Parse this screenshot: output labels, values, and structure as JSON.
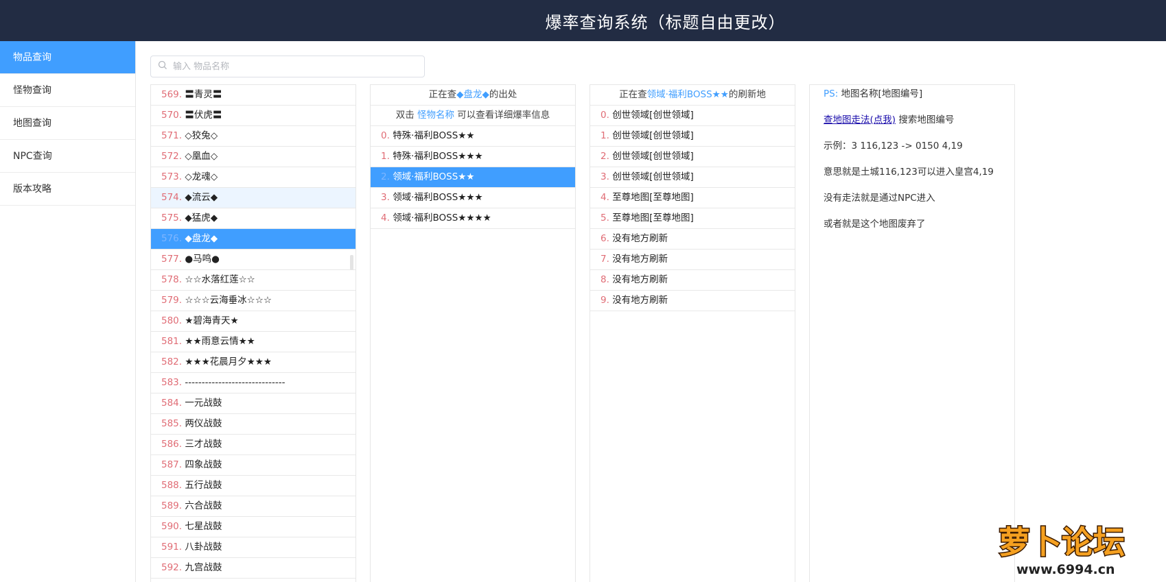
{
  "header": {
    "title": "爆率查询系统（标题自由更改）"
  },
  "sidebar": {
    "items": [
      {
        "label": "物品查询",
        "active": true
      },
      {
        "label": "怪物查询"
      },
      {
        "label": "地图查询"
      },
      {
        "label": "NPC查询"
      },
      {
        "label": "版本攻略"
      }
    ]
  },
  "search": {
    "placeholder": "输入 物品名称",
    "value": ""
  },
  "items_panel": {
    "rows": [
      {
        "idx": "569.",
        "name": "〓青灵〓"
      },
      {
        "idx": "570.",
        "name": "〓伏虎〓"
      },
      {
        "idx": "571.",
        "name": "◇狡兔◇"
      },
      {
        "idx": "572.",
        "name": "◇凰血◇"
      },
      {
        "idx": "573.",
        "name": "◇龙魂◇"
      },
      {
        "idx": "574.",
        "name": "◆流云◆"
      },
      {
        "idx": "575.",
        "name": "◆猛虎◆"
      },
      {
        "idx": "576.",
        "name": "◆盘龙◆"
      },
      {
        "idx": "577.",
        "name": "●马鸣●"
      },
      {
        "idx": "578.",
        "name": "☆☆水落红莲☆☆"
      },
      {
        "idx": "579.",
        "name": "☆☆☆云海垂冰☆☆☆"
      },
      {
        "idx": "580.",
        "name": "★碧海青天★"
      },
      {
        "idx": "581.",
        "name": "★★雨意云情★★"
      },
      {
        "idx": "582.",
        "name": "★★★花晨月夕★★★"
      },
      {
        "idx": "583.",
        "name": "------------------------------"
      },
      {
        "idx": "584.",
        "name": "一元战鼓"
      },
      {
        "idx": "585.",
        "name": "两仪战鼓"
      },
      {
        "idx": "586.",
        "name": "三才战鼓"
      },
      {
        "idx": "587.",
        "name": "四象战鼓"
      },
      {
        "idx": "588.",
        "name": "五行战鼓"
      },
      {
        "idx": "589.",
        "name": "六合战鼓"
      },
      {
        "idx": "590.",
        "name": "七星战鼓"
      },
      {
        "idx": "591.",
        "name": "八卦战鼓"
      },
      {
        "idx": "592.",
        "name": "九宫战鼓"
      }
    ]
  },
  "monster_panel": {
    "head_prefix": "正在查",
    "head_item": "◆盘龙◆",
    "head_suffix": "的出处",
    "hint_prefix": "双击 ",
    "hint_link": "怪物名称",
    "hint_suffix": " 可以查看详细爆率信息",
    "rows": [
      {
        "idx": "0.",
        "name": "特殊·福利BOSS★★"
      },
      {
        "idx": "1.",
        "name": "特殊·福利BOSS★★★"
      },
      {
        "idx": "2.",
        "name": "领域·福利BOSS★★"
      },
      {
        "idx": "3.",
        "name": "领域·福利BOSS★★★"
      },
      {
        "idx": "4.",
        "name": "领域·福利BOSS★★★★"
      }
    ]
  },
  "map_panel": {
    "head_prefix": "正在查",
    "head_item": "领域·福利BOSS★★",
    "head_suffix": "的刷新地",
    "rows": [
      {
        "idx": "0.",
        "name": "创世领域[创世领域]"
      },
      {
        "idx": "1.",
        "name": "创世领域[创世领域]"
      },
      {
        "idx": "2.",
        "name": "创世领域[创世领域]"
      },
      {
        "idx": "3.",
        "name": "创世领域[创世领域]"
      },
      {
        "idx": "4.",
        "name": "至尊地图[至尊地图]"
      },
      {
        "idx": "5.",
        "name": "至尊地图[至尊地图]"
      },
      {
        "idx": "6.",
        "name": "没有地方刷新"
      },
      {
        "idx": "7.",
        "name": "没有地方刷新"
      },
      {
        "idx": "8.",
        "name": "没有地方刷新"
      },
      {
        "idx": "9.",
        "name": "没有地方刷新"
      }
    ]
  },
  "info_panel": {
    "ps_label": "PS:",
    "ps_text": " 地图名称[地图编号]",
    "link_text": "查地图走法(点我)",
    "link_suffix": " 搜索地图编号",
    "example": "示例：3 116,123 -> 0150 4,19",
    "meaning": "意思就是土城116,123可以进入皇宫4,19",
    "no_route": "没有走法就是通过NPC进入",
    "abandoned": "或者就是这个地图废弃了"
  },
  "watermark": {
    "text": "萝卜论坛",
    "url": "www.6994.cn"
  },
  "colors": {
    "accent": "#409eff",
    "header_bg": "#222c43",
    "index_red": "#e06c75"
  }
}
